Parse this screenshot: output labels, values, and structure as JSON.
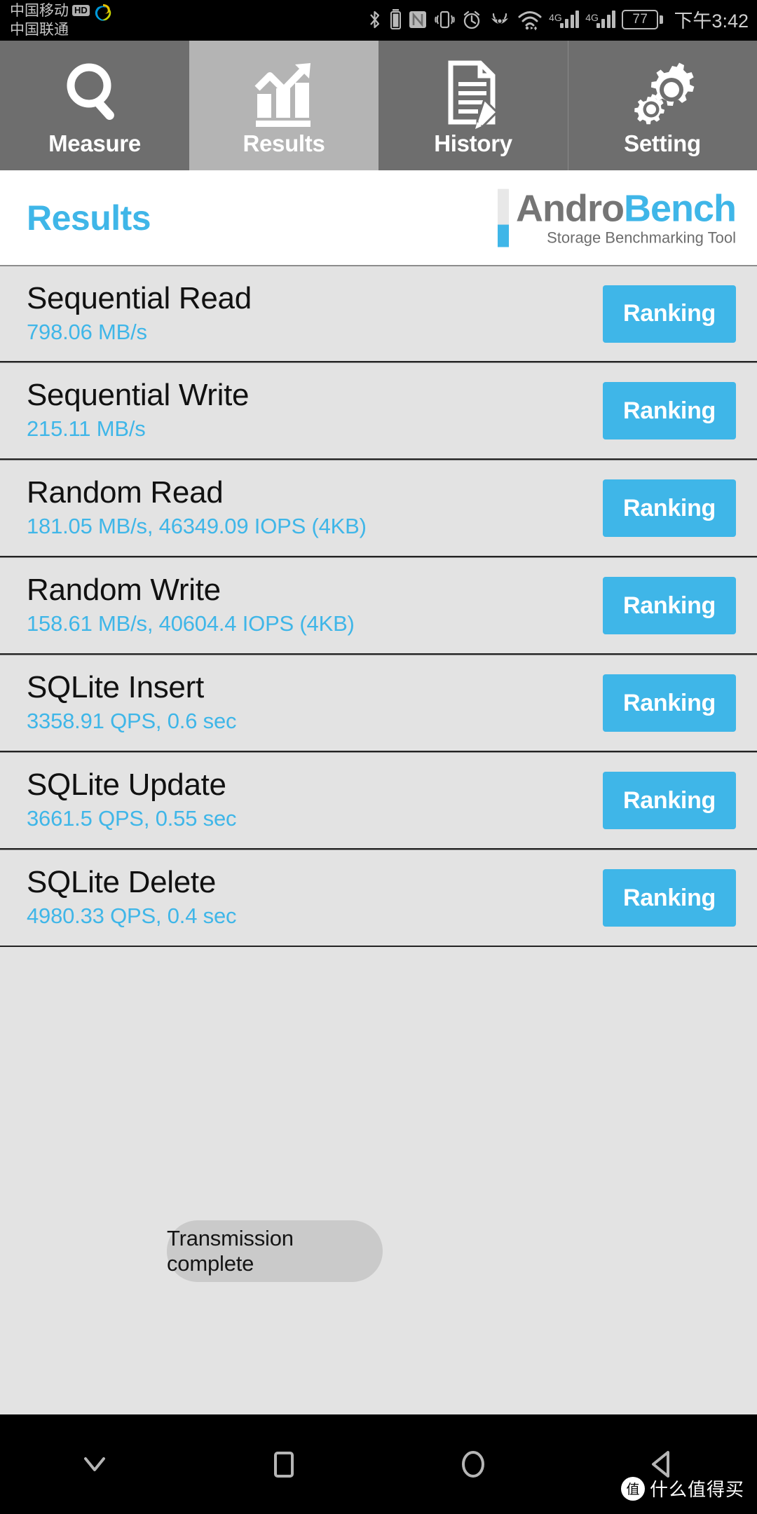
{
  "status_bar": {
    "carrier_primary": "中国移动",
    "carrier_primary_badge": "HD",
    "carrier_secondary": "中国联通",
    "icons": [
      "bluetooth-icon",
      "nfc-icon",
      "vibrate-icon",
      "alarm-icon",
      "eye-care-icon",
      "wifi-icon",
      "signal-4g-sim1-icon",
      "signal-4g-sim2-icon"
    ],
    "network_label_1": "4G",
    "network_label_2": "4G",
    "battery_percent": "77",
    "time": "下午3:42"
  },
  "tabs": [
    {
      "label": "Measure",
      "icon": "magnifier-icon",
      "active": false
    },
    {
      "label": "Results",
      "icon": "bar-chart-arrow-icon",
      "active": true
    },
    {
      "label": "History",
      "icon": "document-pencil-icon",
      "active": false
    },
    {
      "label": "Setting",
      "icon": "gears-icon",
      "active": false
    }
  ],
  "header": {
    "title": "Results",
    "brand_part1": "Andro",
    "brand_part2": "Bench",
    "brand_tagline": "Storage Benchmarking Tool"
  },
  "results": [
    {
      "title": "Sequential Read",
      "value": "798.06 MB/s",
      "button": "Ranking"
    },
    {
      "title": "Sequential Write",
      "value": "215.11 MB/s",
      "button": "Ranking"
    },
    {
      "title": "Random Read",
      "value": "181.05 MB/s, 46349.09 IOPS (4KB)",
      "button": "Ranking"
    },
    {
      "title": "Random Write",
      "value": "158.61 MB/s, 40604.4 IOPS (4KB)",
      "button": "Ranking"
    },
    {
      "title": "SQLite Insert",
      "value": "3358.91 QPS, 0.6 sec",
      "button": "Ranking"
    },
    {
      "title": "SQLite Update",
      "value": "3661.5 QPS, 0.55 sec",
      "button": "Ranking"
    },
    {
      "title": "SQLite Delete",
      "value": "4980.33 QPS, 0.4 sec",
      "button": "Ranking"
    }
  ],
  "toast": {
    "message": "Transmission complete"
  },
  "nav_bar": {
    "buttons": [
      "chevron-down-icon",
      "recents-square-icon",
      "home-circle-icon",
      "back-triangle-icon"
    ]
  },
  "watermark": {
    "mark": "值",
    "text": "什么值得买"
  },
  "colors": {
    "accent": "#3fb6e8",
    "tab_inactive": "#6e6e6e",
    "tab_active": "#b4b4b4",
    "row_bg": "#e3e3e3",
    "status_bar_bg": "#000000"
  }
}
